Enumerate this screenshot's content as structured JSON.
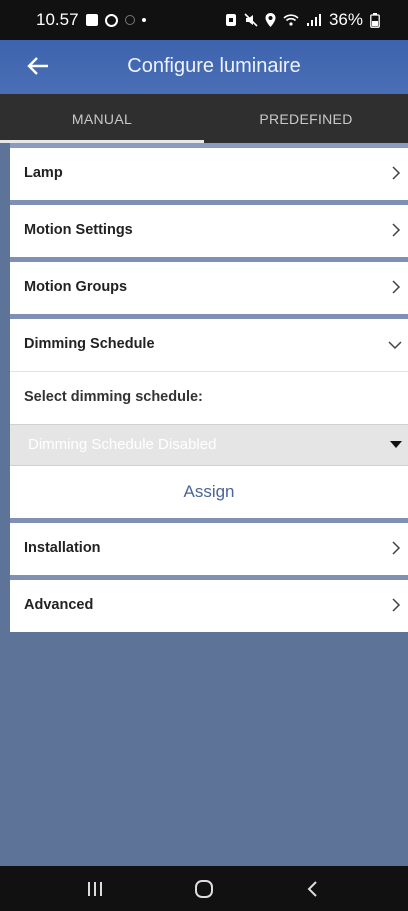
{
  "status_bar": {
    "time": "10.57",
    "battery": "36%",
    "icons": [
      "gallery-icon",
      "drive-icon",
      "circle-icon",
      "dot-icon",
      "sim-icon",
      "mute-icon",
      "location-icon",
      "wifi-icon",
      "signal-icon",
      "battery-icon"
    ]
  },
  "app_bar": {
    "title": "Configure luminaire",
    "back_icon": "arrow-left-icon",
    "background": "#3d63ae"
  },
  "tabs": [
    {
      "label": "MANUAL",
      "active": true
    },
    {
      "label": "PREDEFINED",
      "active": false
    }
  ],
  "sections": {
    "lamp": "Lamp",
    "motion_settings": "Motion Settings",
    "motion_groups": "Motion Groups",
    "dimming_schedule": "Dimming Schedule",
    "installation": "Installation",
    "advanced": "Advanced"
  },
  "dimming": {
    "select_label": "Select dimming schedule:",
    "selected_value": "Dimming Schedule Disabled",
    "assign_label": "Assign"
  },
  "colors": {
    "page_background": "#5d7398",
    "accent": "#4a6597",
    "separator": "#7f90b3"
  },
  "nav_bar": {
    "buttons": [
      "recents-icon",
      "home-icon",
      "back-icon"
    ]
  }
}
